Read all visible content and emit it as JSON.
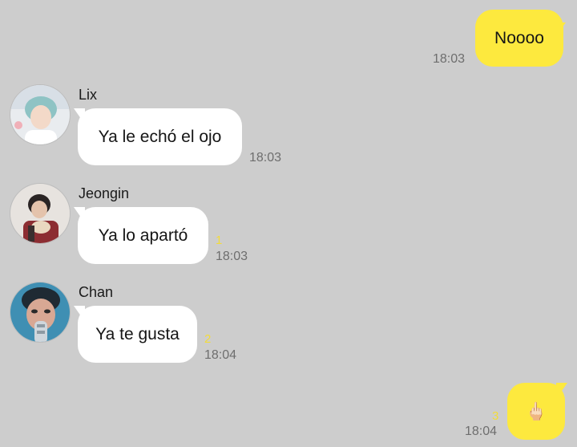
{
  "colors": {
    "background": "#cdcdcd",
    "outgoing_bubble": "#fde93e",
    "incoming_bubble": "#ffffff",
    "unread_count": "#f3dc3a",
    "timestamp": "#6e6e6e"
  },
  "messages": [
    {
      "direction": "outgoing",
      "text": "Noooo",
      "time": "18:03"
    },
    {
      "direction": "incoming",
      "sender": "Lix",
      "text": "Ya le echó el ojo",
      "time": "18:03",
      "avatar_icon": "profile-photo"
    },
    {
      "direction": "incoming",
      "sender": "Jeongin",
      "text": "Ya lo apartó",
      "time": "18:03",
      "unread": "1",
      "avatar_icon": "profile-photo"
    },
    {
      "direction": "incoming",
      "sender": "Chan",
      "text": "Ya te gusta",
      "time": "18:04",
      "unread": "2",
      "avatar_icon": "profile-photo"
    },
    {
      "direction": "outgoing",
      "text": "🖕🏻",
      "time": "18:04",
      "unread": "3"
    }
  ]
}
